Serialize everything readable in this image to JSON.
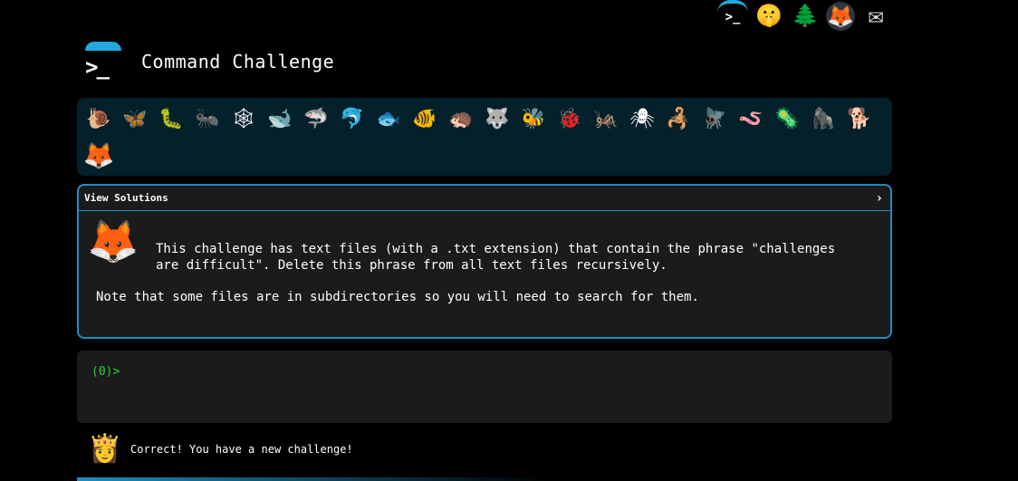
{
  "top_icons": [
    {
      "name": "terminal-icon",
      "glyph": ">_"
    },
    {
      "name": "shushing-face-icon",
      "glyph": "🤫"
    },
    {
      "name": "tree-icon",
      "glyph": "🌲"
    },
    {
      "name": "gitlab-icon",
      "glyph": "🦊"
    },
    {
      "name": "mail-icon",
      "glyph": "✉"
    }
  ],
  "header": {
    "logo_prompt": ">_",
    "title": "Command Challenge"
  },
  "challenge_strip": [
    {
      "name": "snail",
      "glyph": "🐌"
    },
    {
      "name": "butterfly",
      "glyph": "🦋"
    },
    {
      "name": "caterpillar",
      "glyph": "🐛"
    },
    {
      "name": "ant",
      "glyph": "🐜"
    },
    {
      "name": "spider-web",
      "glyph": "🕸"
    },
    {
      "name": "whale",
      "glyph": "🐋"
    },
    {
      "name": "shark",
      "glyph": "🦈"
    },
    {
      "name": "dolphin",
      "glyph": "🐬"
    },
    {
      "name": "fish",
      "glyph": "🐟"
    },
    {
      "name": "tropical-fish",
      "glyph": "🐠"
    },
    {
      "name": "hedgehog",
      "glyph": "🦔"
    },
    {
      "name": "wolf",
      "glyph": "🐺"
    },
    {
      "name": "bee",
      "glyph": "🐝"
    },
    {
      "name": "lady-beetle",
      "glyph": "🐞"
    },
    {
      "name": "cricket",
      "glyph": "🦗"
    },
    {
      "name": "spider",
      "glyph": "🕷"
    },
    {
      "name": "scorpion",
      "glyph": "🦂"
    },
    {
      "name": "fly",
      "glyph": "🪰"
    },
    {
      "name": "worm",
      "glyph": "🪱"
    },
    {
      "name": "microbe",
      "glyph": "🦠"
    },
    {
      "name": "gorilla",
      "glyph": "🦍"
    },
    {
      "name": "dog",
      "glyph": "🐕"
    },
    {
      "name": "fox",
      "glyph": "🦊",
      "current": true
    }
  ],
  "panel": {
    "header_label": "View Solutions",
    "chevron": "›",
    "mascot_glyph": "🦊",
    "description": "This challenge has text files (with a .txt extension) that contain the phrase \"challenges are difficult\". Delete this phrase from all text files recursively.",
    "note": "Note that some files are in subdirectories so you will need to search for them."
  },
  "terminal": {
    "prompt": "(0)>",
    "input_value": ""
  },
  "status": {
    "avatar_glyph": "👸",
    "message": "Correct! You have a new challenge!"
  }
}
